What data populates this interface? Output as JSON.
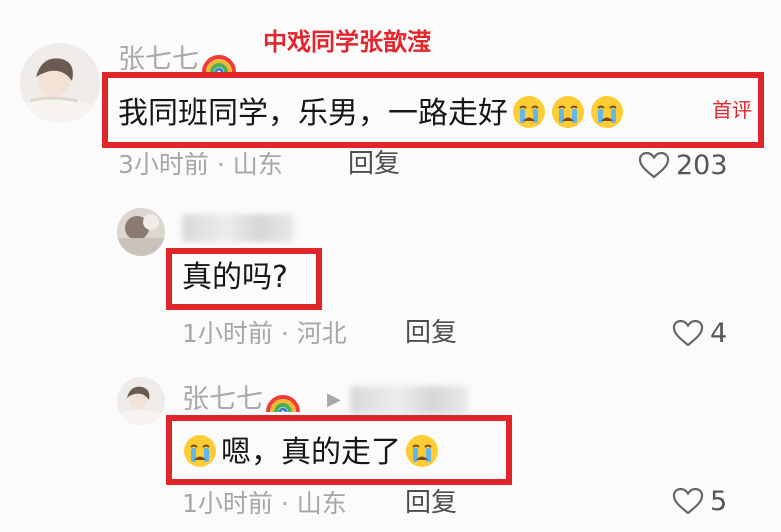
{
  "caption": "中戏同学张歆滢",
  "comments": [
    {
      "username": "张七七",
      "text": "我同班同学，乐男，一路走好",
      "badge": "首评",
      "time": "3小时前",
      "location": "山东",
      "reply_label": "回复",
      "likes": "203"
    },
    {
      "username": "",
      "text": "真的吗?",
      "time": "1小时前",
      "location": "河北",
      "reply_label": "回复",
      "likes": "4"
    },
    {
      "username": "张七七",
      "reply_to": "",
      "text": "嗯，真的走了",
      "time": "1小时前",
      "location": "山东",
      "reply_label": "回复",
      "likes": "5"
    }
  ],
  "meta_separator": " · ",
  "colors": {
    "highlight_red": "#e1262b",
    "meta_gray": "#a7a7a7",
    "text": "#161616"
  },
  "icons": [
    "rainbow-icon",
    "loudly-crying-face-emoji",
    "heart-icon",
    "caret-right-icon"
  ]
}
